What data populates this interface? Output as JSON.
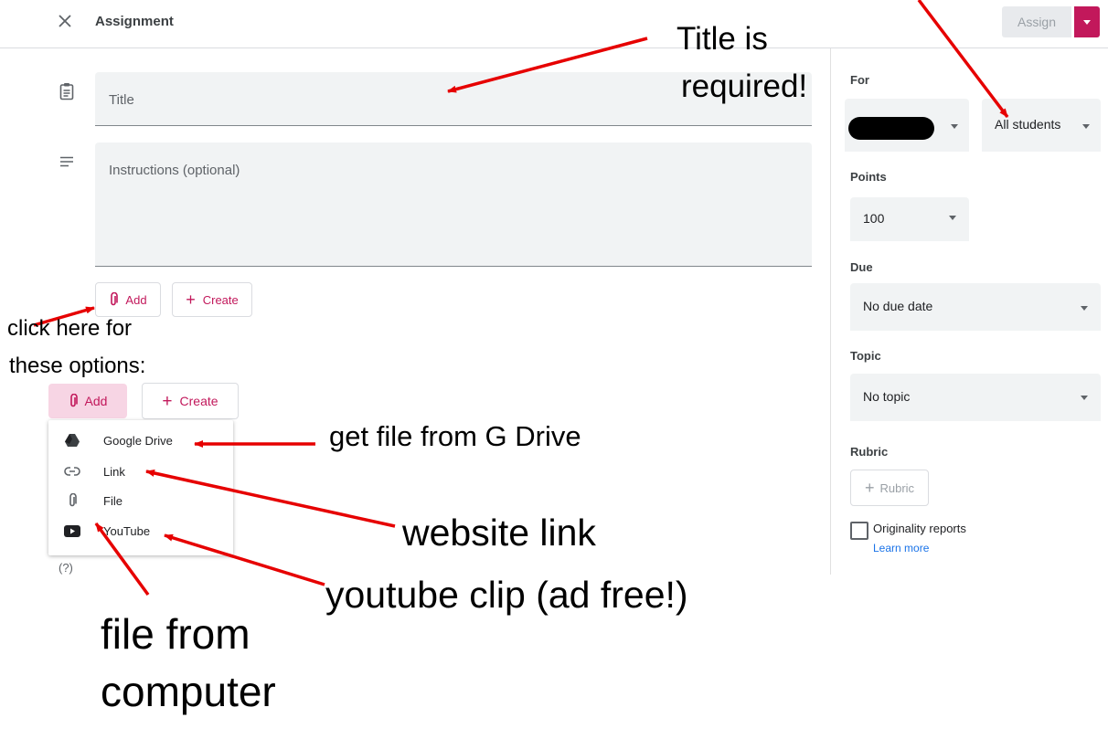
{
  "header": {
    "title": "Assignment",
    "assign_label": "Assign"
  },
  "form": {
    "title_placeholder": "Title",
    "instructions_placeholder": "Instructions (optional)",
    "add_label": "Add",
    "create_label": "Create"
  },
  "sidebar": {
    "for_label": "For",
    "students_value": "All students",
    "points_label": "Points",
    "points_value": "100",
    "due_label": "Due",
    "due_value": "No due date",
    "topic_label": "Topic",
    "topic_value": "No topic",
    "rubric_label": "Rubric",
    "rubric_button": "Rubric",
    "originality_label": "Originality reports",
    "learn_more": "Learn more"
  },
  "menu": {
    "add_label": "Add",
    "create_label": "Create",
    "items": [
      {
        "label": "Google Drive",
        "icon": "google-drive-icon"
      },
      {
        "label": "Link",
        "icon": "link-icon"
      },
      {
        "label": "File",
        "icon": "paperclip-icon"
      },
      {
        "label": "YouTube",
        "icon": "youtube-icon"
      }
    ],
    "help": "(?)"
  },
  "annotations": {
    "title_required_1": "Title is",
    "title_required_2": "required!",
    "click_here_1": "click here for",
    "click_here_2": "these options:",
    "drive": "get file from G Drive",
    "website": "website link",
    "youtube": "youtube clip (ad free!)",
    "file_1": "file from",
    "file_2": "computer"
  },
  "colors": {
    "accent": "#c2185b",
    "annotation_arrow": "#e60000",
    "field_bg": "#f1f3f4"
  }
}
